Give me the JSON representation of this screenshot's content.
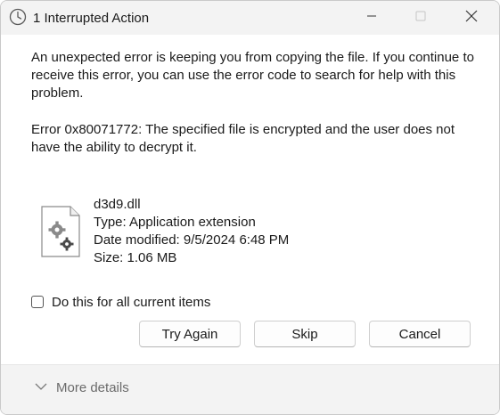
{
  "window": {
    "title": "1 Interrupted Action",
    "icons": {
      "title": "clock-icon",
      "minimize": "minimize-icon",
      "maximize": "maximize-icon",
      "close": "close-icon"
    }
  },
  "message": {
    "description": "An unexpected error is keeping you from copying the file. If you continue to receive this error, you can use the error code to search for help with this problem.",
    "error": "Error 0x80071772: The specified file is encrypted and the user does not have the ability to decrypt it."
  },
  "file": {
    "icon": "dll-file-gears-icon",
    "name": "d3d9.dll",
    "type": "Type: Application extension",
    "date_modified": "Date modified: 9/5/2024 6:48 PM",
    "size": "Size: 1.06 MB"
  },
  "checkbox": {
    "label": "Do this for all current items",
    "checked": false
  },
  "buttons": {
    "try_again": "Try Again",
    "skip": "Skip",
    "cancel": "Cancel"
  },
  "footer": {
    "more_details": "More details",
    "icon": "chevron-down-icon"
  },
  "colors": {
    "titlebar": "#f3f3f3",
    "footer": "#f3f3f3",
    "text": "#1a1a1a",
    "muted": "#6b6b6b"
  }
}
